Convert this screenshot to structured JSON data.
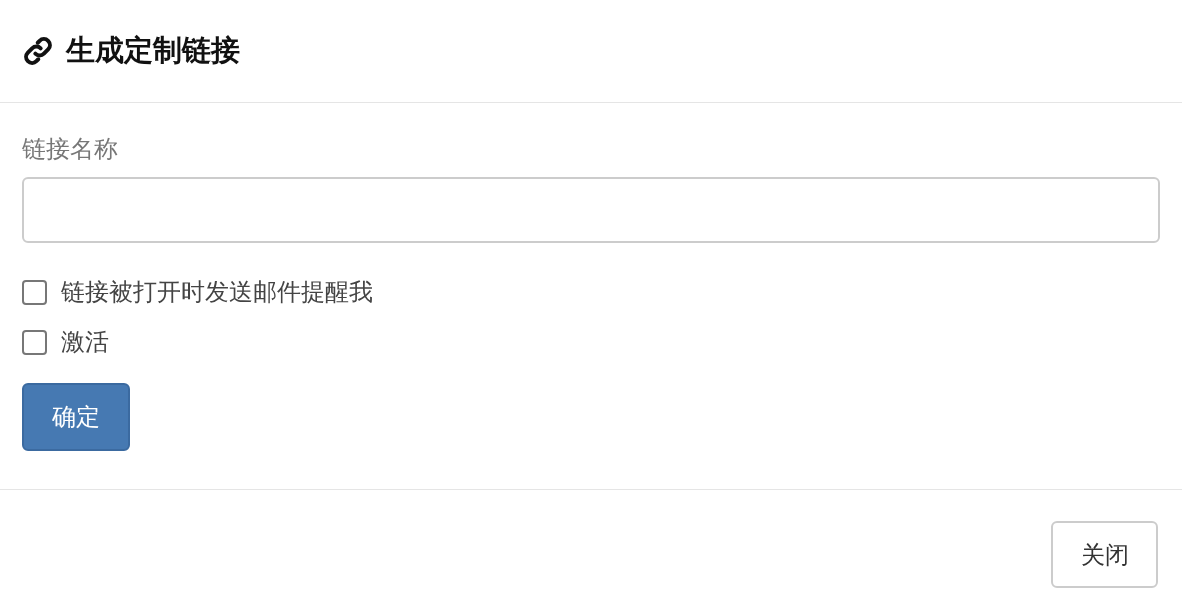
{
  "dialog": {
    "title": "生成定制链接"
  },
  "form": {
    "name_label": "链接名称",
    "options": [
      {
        "label": "链接被打开时发送邮件提醒我",
        "checked": false
      },
      {
        "label": "激活",
        "checked": false
      }
    ],
    "submit": "确定"
  },
  "footer": {
    "close": "关闭"
  }
}
